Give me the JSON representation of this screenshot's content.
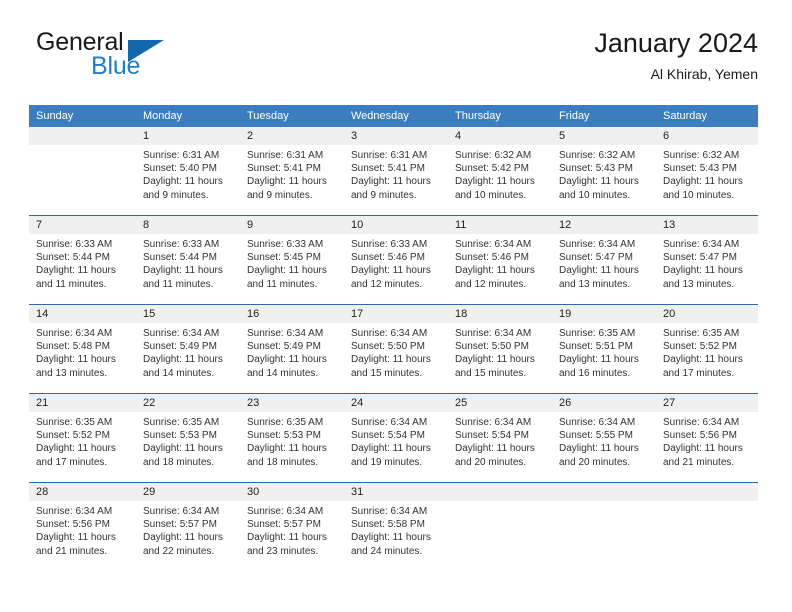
{
  "brand": {
    "name_top": "General",
    "name_bottom": "Blue",
    "flag_icon": "triangle-flag-icon",
    "accent_color": "#1368ab",
    "blue_text_color": "#1f7fc4"
  },
  "header": {
    "title": "January 2024",
    "subtitle": "Al Khirab, Yemen"
  },
  "theme": {
    "header_row_color": "#3a7ebf",
    "row_divider_color": "#2a6ca8",
    "daynum_band_color": "#f0f0f0"
  },
  "weekday_headers": [
    "Sunday",
    "Monday",
    "Tuesday",
    "Wednesday",
    "Thursday",
    "Friday",
    "Saturday"
  ],
  "weeks": [
    [
      {
        "day": "",
        "sunrise": "",
        "sunset": "",
        "daylight_line1": "",
        "daylight_line2": "",
        "empty": true
      },
      {
        "day": "1",
        "sunrise": "Sunrise: 6:31 AM",
        "sunset": "Sunset: 5:40 PM",
        "daylight_line1": "Daylight: 11 hours",
        "daylight_line2": "and 9 minutes.",
        "empty": false
      },
      {
        "day": "2",
        "sunrise": "Sunrise: 6:31 AM",
        "sunset": "Sunset: 5:41 PM",
        "daylight_line1": "Daylight: 11 hours",
        "daylight_line2": "and 9 minutes.",
        "empty": false
      },
      {
        "day": "3",
        "sunrise": "Sunrise: 6:31 AM",
        "sunset": "Sunset: 5:41 PM",
        "daylight_line1": "Daylight: 11 hours",
        "daylight_line2": "and 9 minutes.",
        "empty": false
      },
      {
        "day": "4",
        "sunrise": "Sunrise: 6:32 AM",
        "sunset": "Sunset: 5:42 PM",
        "daylight_line1": "Daylight: 11 hours",
        "daylight_line2": "and 10 minutes.",
        "empty": false
      },
      {
        "day": "5",
        "sunrise": "Sunrise: 6:32 AM",
        "sunset": "Sunset: 5:43 PM",
        "daylight_line1": "Daylight: 11 hours",
        "daylight_line2": "and 10 minutes.",
        "empty": false
      },
      {
        "day": "6",
        "sunrise": "Sunrise: 6:32 AM",
        "sunset": "Sunset: 5:43 PM",
        "daylight_line1": "Daylight: 11 hours",
        "daylight_line2": "and 10 minutes.",
        "empty": false
      }
    ],
    [
      {
        "day": "7",
        "sunrise": "Sunrise: 6:33 AM",
        "sunset": "Sunset: 5:44 PM",
        "daylight_line1": "Daylight: 11 hours",
        "daylight_line2": "and 11 minutes.",
        "empty": false
      },
      {
        "day": "8",
        "sunrise": "Sunrise: 6:33 AM",
        "sunset": "Sunset: 5:44 PM",
        "daylight_line1": "Daylight: 11 hours",
        "daylight_line2": "and 11 minutes.",
        "empty": false
      },
      {
        "day": "9",
        "sunrise": "Sunrise: 6:33 AM",
        "sunset": "Sunset: 5:45 PM",
        "daylight_line1": "Daylight: 11 hours",
        "daylight_line2": "and 11 minutes.",
        "empty": false
      },
      {
        "day": "10",
        "sunrise": "Sunrise: 6:33 AM",
        "sunset": "Sunset: 5:46 PM",
        "daylight_line1": "Daylight: 11 hours",
        "daylight_line2": "and 12 minutes.",
        "empty": false
      },
      {
        "day": "11",
        "sunrise": "Sunrise: 6:34 AM",
        "sunset": "Sunset: 5:46 PM",
        "daylight_line1": "Daylight: 11 hours",
        "daylight_line2": "and 12 minutes.",
        "empty": false
      },
      {
        "day": "12",
        "sunrise": "Sunrise: 6:34 AM",
        "sunset": "Sunset: 5:47 PM",
        "daylight_line1": "Daylight: 11 hours",
        "daylight_line2": "and 13 minutes.",
        "empty": false
      },
      {
        "day": "13",
        "sunrise": "Sunrise: 6:34 AM",
        "sunset": "Sunset: 5:47 PM",
        "daylight_line1": "Daylight: 11 hours",
        "daylight_line2": "and 13 minutes.",
        "empty": false
      }
    ],
    [
      {
        "day": "14",
        "sunrise": "Sunrise: 6:34 AM",
        "sunset": "Sunset: 5:48 PM",
        "daylight_line1": "Daylight: 11 hours",
        "daylight_line2": "and 13 minutes.",
        "empty": false
      },
      {
        "day": "15",
        "sunrise": "Sunrise: 6:34 AM",
        "sunset": "Sunset: 5:49 PM",
        "daylight_line1": "Daylight: 11 hours",
        "daylight_line2": "and 14 minutes.",
        "empty": false
      },
      {
        "day": "16",
        "sunrise": "Sunrise: 6:34 AM",
        "sunset": "Sunset: 5:49 PM",
        "daylight_line1": "Daylight: 11 hours",
        "daylight_line2": "and 14 minutes.",
        "empty": false
      },
      {
        "day": "17",
        "sunrise": "Sunrise: 6:34 AM",
        "sunset": "Sunset: 5:50 PM",
        "daylight_line1": "Daylight: 11 hours",
        "daylight_line2": "and 15 minutes.",
        "empty": false
      },
      {
        "day": "18",
        "sunrise": "Sunrise: 6:34 AM",
        "sunset": "Sunset: 5:50 PM",
        "daylight_line1": "Daylight: 11 hours",
        "daylight_line2": "and 15 minutes.",
        "empty": false
      },
      {
        "day": "19",
        "sunrise": "Sunrise: 6:35 AM",
        "sunset": "Sunset: 5:51 PM",
        "daylight_line1": "Daylight: 11 hours",
        "daylight_line2": "and 16 minutes.",
        "empty": false
      },
      {
        "day": "20",
        "sunrise": "Sunrise: 6:35 AM",
        "sunset": "Sunset: 5:52 PM",
        "daylight_line1": "Daylight: 11 hours",
        "daylight_line2": "and 17 minutes.",
        "empty": false
      }
    ],
    [
      {
        "day": "21",
        "sunrise": "Sunrise: 6:35 AM",
        "sunset": "Sunset: 5:52 PM",
        "daylight_line1": "Daylight: 11 hours",
        "daylight_line2": "and 17 minutes.",
        "empty": false
      },
      {
        "day": "22",
        "sunrise": "Sunrise: 6:35 AM",
        "sunset": "Sunset: 5:53 PM",
        "daylight_line1": "Daylight: 11 hours",
        "daylight_line2": "and 18 minutes.",
        "empty": false
      },
      {
        "day": "23",
        "sunrise": "Sunrise: 6:35 AM",
        "sunset": "Sunset: 5:53 PM",
        "daylight_line1": "Daylight: 11 hours",
        "daylight_line2": "and 18 minutes.",
        "empty": false
      },
      {
        "day": "24",
        "sunrise": "Sunrise: 6:34 AM",
        "sunset": "Sunset: 5:54 PM",
        "daylight_line1": "Daylight: 11 hours",
        "daylight_line2": "and 19 minutes.",
        "empty": false
      },
      {
        "day": "25",
        "sunrise": "Sunrise: 6:34 AM",
        "sunset": "Sunset: 5:54 PM",
        "daylight_line1": "Daylight: 11 hours",
        "daylight_line2": "and 20 minutes.",
        "empty": false
      },
      {
        "day": "26",
        "sunrise": "Sunrise: 6:34 AM",
        "sunset": "Sunset: 5:55 PM",
        "daylight_line1": "Daylight: 11 hours",
        "daylight_line2": "and 20 minutes.",
        "empty": false
      },
      {
        "day": "27",
        "sunrise": "Sunrise: 6:34 AM",
        "sunset": "Sunset: 5:56 PM",
        "daylight_line1": "Daylight: 11 hours",
        "daylight_line2": "and 21 minutes.",
        "empty": false
      }
    ],
    [
      {
        "day": "28",
        "sunrise": "Sunrise: 6:34 AM",
        "sunset": "Sunset: 5:56 PM",
        "daylight_line1": "Daylight: 11 hours",
        "daylight_line2": "and 21 minutes.",
        "empty": false
      },
      {
        "day": "29",
        "sunrise": "Sunrise: 6:34 AM",
        "sunset": "Sunset: 5:57 PM",
        "daylight_line1": "Daylight: 11 hours",
        "daylight_line2": "and 22 minutes.",
        "empty": false
      },
      {
        "day": "30",
        "sunrise": "Sunrise: 6:34 AM",
        "sunset": "Sunset: 5:57 PM",
        "daylight_line1": "Daylight: 11 hours",
        "daylight_line2": "and 23 minutes.",
        "empty": false
      },
      {
        "day": "31",
        "sunrise": "Sunrise: 6:34 AM",
        "sunset": "Sunset: 5:58 PM",
        "daylight_line1": "Daylight: 11 hours",
        "daylight_line2": "and 24 minutes.",
        "empty": false
      },
      {
        "day": "",
        "sunrise": "",
        "sunset": "",
        "daylight_line1": "",
        "daylight_line2": "",
        "empty": true
      },
      {
        "day": "",
        "sunrise": "",
        "sunset": "",
        "daylight_line1": "",
        "daylight_line2": "",
        "empty": true
      },
      {
        "day": "",
        "sunrise": "",
        "sunset": "",
        "daylight_line1": "",
        "daylight_line2": "",
        "empty": true
      }
    ]
  ]
}
